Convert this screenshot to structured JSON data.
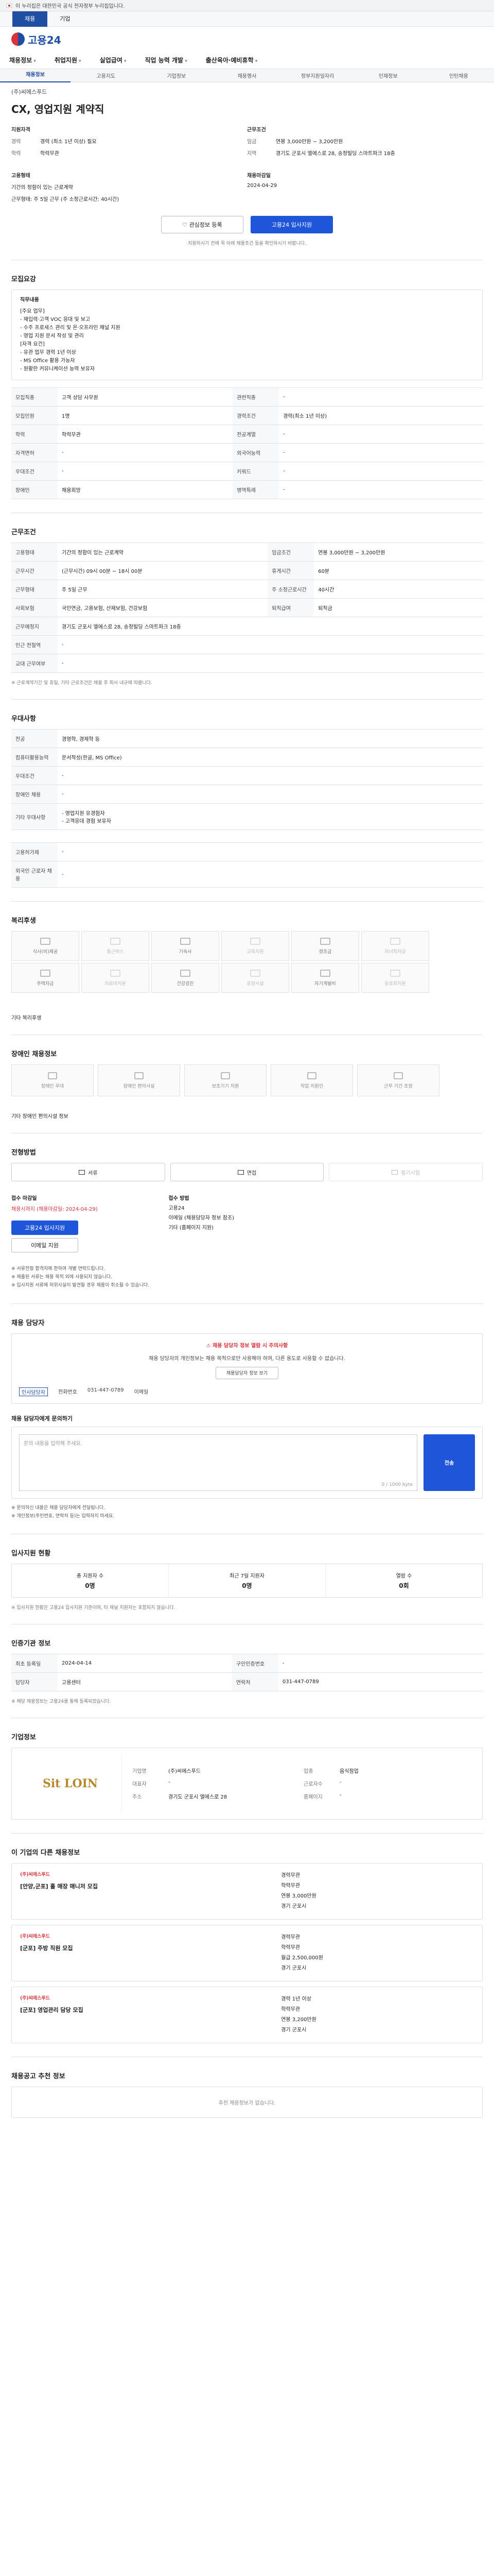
{
  "gov_banner": "이 누리집은 대한민국 공식 전자정부 누리집입니다.",
  "lang_tabs": [
    "채용",
    "기업"
  ],
  "brand": "고용24",
  "gnb": [
    "채용정보",
    "취업지원",
    "실업급여",
    "직업 능력 개발",
    "출산육아·예비휴학"
  ],
  "subnav": [
    "채용정보",
    "고용지도",
    "기업정보",
    "채용행사",
    "정부지원일자리",
    "인재정보",
    "인턴채용"
  ],
  "company_name": "(주)씨에스푸드",
  "job_title": "CX, 영업지원 계약직",
  "header": {
    "left_label": "지원자격",
    "left_rows": [
      {
        "k": "경력",
        "v": "경력 (최소 1년 이상) 필요"
      },
      {
        "k": "학력",
        "v": "학력무관"
      }
    ],
    "left_label2": "고용형태",
    "left_rows2": [
      {
        "k": "",
        "v": "기간의 정함이 있는 근로계약"
      },
      {
        "k": "",
        "v": "근무형태: 주 5일 근무 (주 소정근로시간: 40시간)"
      }
    ],
    "right_label": "근무조건",
    "right_rows": [
      {
        "k": "임금",
        "v": "연봉 3,000만원 ~ 3,200만원"
      },
      {
        "k": "지역",
        "v": "경기도 군포시 엘에스로 28, 송정빌딩 스마트파크 18층"
      }
    ],
    "right_label2": "채용마감일",
    "right_rows2": [
      {
        "k": "",
        "v": "2024-04-29"
      }
    ]
  },
  "buttons": {
    "scrap": "관심정보 등록",
    "apply": "고용24 입사지원"
  },
  "header_note": "지원하시기 전에 꼭 아래 채용조건 등을 확인하시기 바랍니다.",
  "sections": {
    "jobinfo": "모집요강",
    "conditions": "근무조건",
    "docs": "우대사항",
    "welfare": "복리후생",
    "disabled": "장애인 채용정보",
    "process": "전형방법",
    "contact": "채용 담당자",
    "stats": "입사지원 현황",
    "manager": "인증기관 정보",
    "company": "기업정보",
    "related": "이 기업의 다른 채용정보",
    "recommend": "채용공고 추천 정보"
  },
  "jobinfo": {
    "title": "직무내용",
    "lines": [
      "[주요 업무]",
      "- 재입력·고객 VOC 응대 및 보고",
      "- 수주 프로세스 관리 및 온·오프라인 채널 지원",
      "- 영업 지원 문서 작성 및 관리",
      "[자격 요건]",
      "- 유관 업무 경력 1년 이상",
      "- MS Office 활용 가능자",
      "- 원활한 커뮤니케이션 능력 보유자"
    ]
  },
  "job_table": [
    {
      "k": "모집직종",
      "v": "고객 상담 사무원",
      "k2": "관련직종",
      "v2": "-"
    },
    {
      "k": "모집인원",
      "v": "1명",
      "k2": "경력조건",
      "v2": "경력(최소 1년 이상)"
    },
    {
      "k": "학력",
      "v": "학력무관",
      "k2": "전공계열",
      "v2": "-"
    },
    {
      "k": "자격면허",
      "v": "-",
      "k2": "외국어능력",
      "v2": "-"
    },
    {
      "k": "우대조건",
      "v": "-",
      "k2": "키워드",
      "v2": "-"
    },
    {
      "k": "장애인",
      "v": "채용희망",
      "k2": "병역특례",
      "v2": "-"
    }
  ],
  "cond_table": [
    {
      "k": "고용형태",
      "v": "기간의 정함이 있는 근로계약",
      "k2": "임금조건",
      "v2": "연봉 3,000만원 ~ 3,200만원"
    },
    {
      "k": "근무시간",
      "v": "(근무시간) 09시 00분 ~ 18시 00분",
      "k2": "휴게시간",
      "v2": "60분"
    },
    {
      "k": "근무형태",
      "v": "주 5일 근무",
      "k2": "주 소정근로시간",
      "v2": "40시간"
    },
    {
      "k": "사회보험",
      "v": "국민연금, 고용보험, 산재보험, 건강보험",
      "k2": "퇴직급여",
      "v2": "퇴직금"
    },
    {
      "k": "근무예정지",
      "v": "경기도 군포시 엘에스로 28, 송정빌딩 스마트파크 18층",
      "k2": "",
      "v2": ""
    },
    {
      "k": "인근 전철역",
      "v": "-",
      "k2": "",
      "v2": ""
    },
    {
      "k": "교대 근무여부",
      "v": "-",
      "k2": "",
      "v2": ""
    }
  ],
  "cond_note": "※ 근로계약기간 및 휴일, 기타 근로조건은 채용 후 회사 내규에 따릅니다.",
  "pref_table": [
    {
      "k": "전공",
      "v": "경영학, 경제학 등"
    },
    {
      "k": "컴퓨터활용능력",
      "v": "문서작성(한글, MS Office)"
    },
    {
      "k": "우대조건",
      "v": "-"
    },
    {
      "k": "장애인 채용",
      "v": "-"
    },
    {
      "k": "기타 우대사항",
      "v": "- 영업지원 유경험자\n- 고객응대 경험 보유자"
    }
  ],
  "etc_table": [
    {
      "k": "고용허가제",
      "v": "-"
    },
    {
      "k": "외국인 근로자 채용",
      "v": "-"
    }
  ],
  "welfare_icons": [
    "식사(비)제공",
    "통근버스",
    "기숙사",
    "교육지원",
    "경조금",
    "자녀학자금",
    "주택자금",
    "의료비지원",
    "건강검진",
    "휴양시설",
    "자기계발비",
    "동호회지원"
  ],
  "welfare_note": "기타 복리후생",
  "disabled_icons": [
    "장애인 우대",
    "장애인 편의시설",
    "보조기기 지원",
    "작업 지원인",
    "근무 기간 조정"
  ],
  "disabled_note": "기타 장애인 편의시설 정보",
  "process_methods": [
    "서류",
    "면접",
    "필기시험"
  ],
  "process_cols": {
    "left_title": "접수 마감일",
    "left_sub": "채용시까지 (채용마감일: 2024-04-29)",
    "apply_btn": "고용24 입사지원",
    "apply_btn2": "이메일 지원",
    "right_title": "접수 방법",
    "right_rows": [
      "고용24",
      "이메일 (채용담당자 정보 참조)",
      "기타 (홈페이지 지원)"
    ]
  },
  "process_notes": [
    "※ 서류전형 합격자에 한하여 개별 연락드립니다.",
    "※ 제출된 서류는 채용 목적 외에 사용되지 않습니다.",
    "※ 입사지원 서류에 허위사실이 발견될 경우 채용이 취소될 수 있습니다."
  ],
  "contact": {
    "warn": "채용 담당자 정보 열람 시 주의사항",
    "desc": "채용 담당자의 개인정보는 채용 목적으로만 사용해야 하며, 다른 용도로 사용할 수 없습니다.",
    "btn": "채용담당자 정보 보기",
    "name_label": "인사담당자",
    "phone_label": "전화번호",
    "phone": "031-447-0789",
    "email_label": "이메일"
  },
  "inquiry": {
    "title": "채용 담당자에게 문의하기",
    "placeholder": "문의 내용을 입력해 주세요.",
    "count": "0 / 1000 byte",
    "send": "전송",
    "notes": [
      "※ 문의하신 내용은 채용 담당자에게 전달됩니다.",
      "※ 개인정보(주민번호, 연락처 등)는 입력하지 마세요."
    ]
  },
  "stats": [
    {
      "label": "총 지원자 수",
      "value": "0명"
    },
    {
      "label": "최근 7일 지원자",
      "value": "0명"
    },
    {
      "label": "열람 수",
      "value": "0회"
    }
  ],
  "stats_note": "※ 입사지원 현황은 고용24 입사지원 기준이며, 타 채널 지원자는 포함되지 않습니다.",
  "manager_table": [
    {
      "k": "최초 등록일",
      "v": "2024-04-14",
      "k2": "구인인증번호",
      "v2": "-"
    },
    {
      "k": "담당자",
      "v": "고용센터",
      "k2": "연락처",
      "v2": "031-447-0789"
    }
  ],
  "manager_note": "※ 해당 채용정보는 고용24를 통해 등록되었습니다.",
  "company": {
    "logo_text": "Sit LOIN",
    "fields": [
      {
        "k": "기업명",
        "v": "(주)씨에스푸드"
      },
      {
        "k": "업종",
        "v": "음식점업"
      },
      {
        "k": "대표자",
        "v": "-"
      },
      {
        "k": "근로자수",
        "v": "-"
      },
      {
        "k": "주소",
        "v": "경기도 군포시 엘에스로 28"
      },
      {
        "k": "홈페이지",
        "v": "-"
      }
    ]
  },
  "related": [
    {
      "co": "(주)씨에스푸드",
      "title": "[안양,군포] 홀 매장 매니저 모집",
      "r": [
        "경력무관",
        "학력무관",
        "연봉 3,000만원",
        "경기 군포시"
      ]
    },
    {
      "co": "(주)씨에스푸드",
      "title": "[군포] 주방 직원 모집",
      "r": [
        "경력무관",
        "학력무관",
        "월급 2,500,000원",
        "경기 군포시"
      ]
    },
    {
      "co": "(주)씨에스푸드",
      "title": "[군포] 영업관리 담당 모집",
      "r": [
        "경력 1년 이상",
        "학력무관",
        "연봉 3,200만원",
        "경기 군포시"
      ]
    }
  ],
  "recommend_empty": "추천 채용정보가 없습니다."
}
